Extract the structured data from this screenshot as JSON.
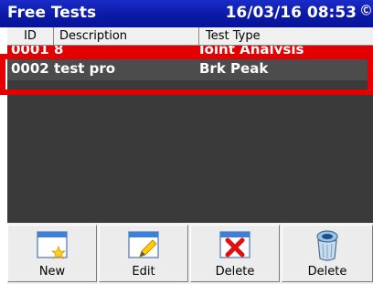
{
  "window": {
    "title": "Free Tests",
    "datetime": "16/03/16 08:53",
    "status_glyph": "Ⓒ"
  },
  "table": {
    "columns": [
      "ID",
      "Description",
      "Test Type"
    ],
    "rows": [
      {
        "id": "0001",
        "description": "8",
        "test_type": "Joint Analysis"
      },
      {
        "id": "0002",
        "description": "test pro",
        "test_type": "Brk Peak"
      }
    ],
    "selected_index": 1
  },
  "toolbar": {
    "buttons": [
      {
        "label": "New",
        "icon": "new-document-icon"
      },
      {
        "label": "Edit",
        "icon": "edit-document-icon"
      },
      {
        "label": "Delete",
        "icon": "delete-x-icon"
      },
      {
        "label": "Delete",
        "icon": "trash-bin-icon"
      }
    ]
  },
  "colors": {
    "titlebar": "#0b1aa6",
    "selection": "#e40000",
    "list_bg": "#3a3a3a"
  }
}
